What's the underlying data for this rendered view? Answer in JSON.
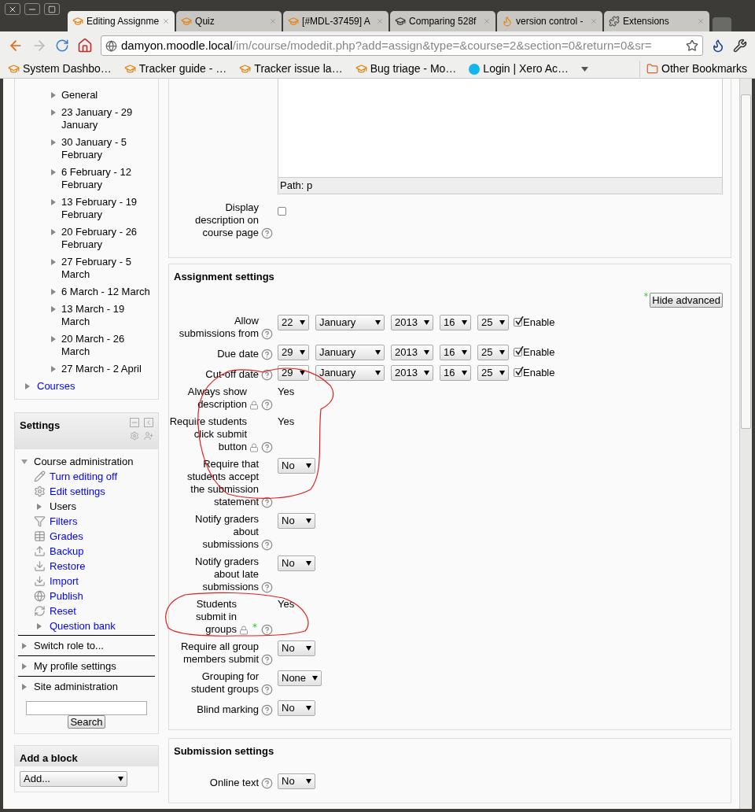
{
  "browser": {
    "tabs": [
      {
        "title": "Editing Assignme",
        "selected": true
      },
      {
        "title": "Quiz",
        "selected": false
      },
      {
        "title": "[#MDL-37459] A",
        "selected": false
      },
      {
        "title": "Comparing 528f",
        "selected": false
      },
      {
        "title": "version control -",
        "selected": false
      },
      {
        "title": "Extensions",
        "selected": false
      }
    ],
    "url": {
      "host": "damyon.moodle.local",
      "path": "/im/course/modedit.php?add=assign&type=&course=2&section=0&return=0&sr="
    },
    "bookmarks": [
      "System Dashbo…",
      "Tracker guide - …",
      "Tracker issue la…",
      "Bug triage - Mo…",
      "Login | Xero Ac…"
    ],
    "other_bookmarks": "Other Bookmarks"
  },
  "navigation": {
    "items": [
      "General",
      "23 January - 29 January",
      "30 January - 5 February",
      "6 February - 12 February",
      "13 February - 19 February",
      "20 February - 26 February",
      "27 February - 5 March",
      "6 March - 12 March",
      "13 March - 19 March",
      "20 March - 26 March",
      "27 March - 2 April"
    ],
    "courses": "Courses"
  },
  "settings_block": {
    "title": "Settings",
    "sections": [
      {
        "label": "Course administration",
        "expanded": true,
        "children": [
          {
            "label": "Turn editing off",
            "kind": "link"
          },
          {
            "label": "Edit settings",
            "kind": "link"
          },
          {
            "label": "Users",
            "kind": "branch"
          },
          {
            "label": "Filters",
            "kind": "link"
          },
          {
            "label": "Grades",
            "kind": "link"
          },
          {
            "label": "Backup",
            "kind": "link"
          },
          {
            "label": "Restore",
            "kind": "link"
          },
          {
            "label": "Import",
            "kind": "link"
          },
          {
            "label": "Publish",
            "kind": "link"
          },
          {
            "label": "Reset",
            "kind": "link"
          },
          {
            "label": "Question bank",
            "kind": "branch_link"
          }
        ]
      },
      {
        "label": "Switch role to...",
        "expanded": false
      },
      {
        "label": "My profile settings",
        "expanded": false
      },
      {
        "label": "Site administration",
        "expanded": false
      }
    ],
    "search_button": "Search"
  },
  "add_block": {
    "title": "Add a block",
    "select": "Add..."
  },
  "editor": {
    "path": "Path: p"
  },
  "general_rows": [
    {
      "label": "Display description on course page",
      "kind": "checkbox",
      "checked": false
    }
  ],
  "assignment_settings": {
    "title": "Assignment settings",
    "hide_advanced": "Hide advanced",
    "rows": [
      {
        "label": "Allow submissions from",
        "kind": "date",
        "parts": [
          "22",
          "January",
          "2013",
          "16",
          "25"
        ],
        "enable": {
          "label": "Enable",
          "checked": true
        }
      },
      {
        "label": "Due date",
        "kind": "date",
        "parts": [
          "29",
          "January",
          "2013",
          "16",
          "25"
        ],
        "enable": {
          "label": "Enable",
          "checked": true
        }
      },
      {
        "label": "Cut-off date",
        "kind": "date",
        "parts": [
          "29",
          "January",
          "2013",
          "16",
          "25"
        ],
        "enable": {
          "label": "Enable",
          "checked": true
        }
      },
      {
        "label": "Always show description",
        "kind": "static",
        "value": "Yes",
        "locked": true
      },
      {
        "label": "Require students click submit button",
        "kind": "static",
        "value": "Yes",
        "locked": true
      },
      {
        "label": "Require that students accept the submission statement",
        "kind": "select",
        "value": "No"
      },
      {
        "label": "Notify graders about submissions",
        "kind": "select",
        "value": "No"
      },
      {
        "label": "Notify graders about late submissions",
        "kind": "select",
        "value": "No"
      },
      {
        "label": "Students submit in groups",
        "kind": "static",
        "value": "Yes",
        "locked": true,
        "advanced": true
      },
      {
        "label": "Require all group members submit",
        "kind": "select",
        "value": "No"
      },
      {
        "label": "Grouping for student groups",
        "kind": "select",
        "value": "None"
      },
      {
        "label": "Blind marking",
        "kind": "select",
        "value": "No"
      }
    ]
  },
  "submission_settings": {
    "title": "Submission settings",
    "rows": [
      {
        "label": "Online text",
        "kind": "select",
        "value": "No"
      }
    ]
  }
}
